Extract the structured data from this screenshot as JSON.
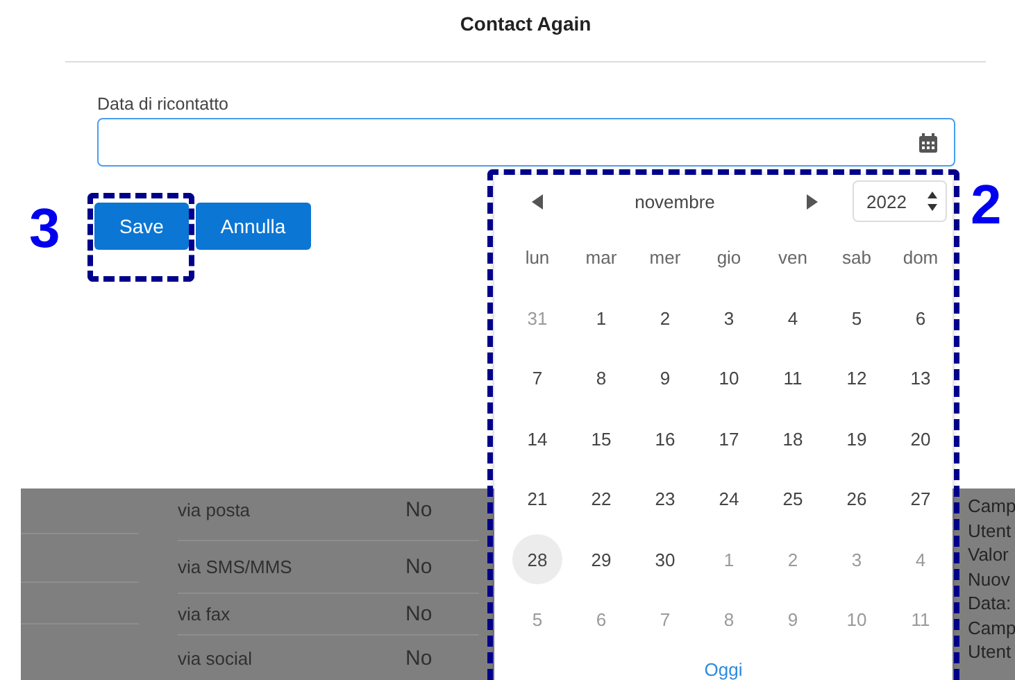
{
  "dialog": {
    "title": "Contact Again",
    "field": {
      "label": "Data di ricontatto"
    },
    "buttons": [
      {
        "label": "Save"
      },
      {
        "label": "Annulla"
      }
    ]
  },
  "background": {
    "rows": [
      {
        "channel": "via posta",
        "value": "No"
      },
      {
        "channel": "via SMS/MMS",
        "value": "No"
      },
      {
        "channel": "via fax",
        "value": "No"
      },
      {
        "channel": "via social",
        "value": "No"
      }
    ],
    "side_text": [
      "Camp",
      "Utent",
      "Valor",
      "Nuov",
      "Data:",
      "Camp",
      "Utent"
    ]
  },
  "datepicker": {
    "month": "novembre",
    "year": "2022",
    "weekdays": [
      "lun",
      "mar",
      "mer",
      "gio",
      "ven",
      "sab",
      "dom"
    ],
    "weeks": [
      [
        {
          "day": "31",
          "other_month": true,
          "today": false
        },
        {
          "day": "1",
          "other_month": false,
          "today": false
        },
        {
          "day": "2",
          "other_month": false,
          "today": false
        },
        {
          "day": "3",
          "other_month": false,
          "today": false
        },
        {
          "day": "4",
          "other_month": false,
          "today": false
        },
        {
          "day": "5",
          "other_month": false,
          "today": false
        },
        {
          "day": "6",
          "other_month": false,
          "today": false
        }
      ],
      [
        {
          "day": "7",
          "other_month": false,
          "today": false
        },
        {
          "day": "8",
          "other_month": false,
          "today": false
        },
        {
          "day": "9",
          "other_month": false,
          "today": false
        },
        {
          "day": "10",
          "other_month": false,
          "today": false
        },
        {
          "day": "11",
          "other_month": false,
          "today": false
        },
        {
          "day": "12",
          "other_month": false,
          "today": false
        },
        {
          "day": "13",
          "other_month": false,
          "today": false
        }
      ],
      [
        {
          "day": "14",
          "other_month": false,
          "today": false
        },
        {
          "day": "15",
          "other_month": false,
          "today": false
        },
        {
          "day": "16",
          "other_month": false,
          "today": false
        },
        {
          "day": "17",
          "other_month": false,
          "today": false
        },
        {
          "day": "18",
          "other_month": false,
          "today": false
        },
        {
          "day": "19",
          "other_month": false,
          "today": false
        },
        {
          "day": "20",
          "other_month": false,
          "today": false
        }
      ],
      [
        {
          "day": "21",
          "other_month": false,
          "today": false
        },
        {
          "day": "22",
          "other_month": false,
          "today": false
        },
        {
          "day": "23",
          "other_month": false,
          "today": false
        },
        {
          "day": "24",
          "other_month": false,
          "today": false
        },
        {
          "day": "25",
          "other_month": false,
          "today": false
        },
        {
          "day": "26",
          "other_month": false,
          "today": false
        },
        {
          "day": "27",
          "other_month": false,
          "today": false
        }
      ],
      [
        {
          "day": "28",
          "other_month": false,
          "today": true
        },
        {
          "day": "29",
          "other_month": false,
          "today": false
        },
        {
          "day": "30",
          "other_month": false,
          "today": false
        },
        {
          "day": "1",
          "other_month": true,
          "today": false
        },
        {
          "day": "2",
          "other_month": true,
          "today": false
        },
        {
          "day": "3",
          "other_month": true,
          "today": false
        },
        {
          "day": "4",
          "other_month": true,
          "today": false
        }
      ],
      [
        {
          "day": "5",
          "other_month": true,
          "today": false
        },
        {
          "day": "6",
          "other_month": true,
          "today": false
        },
        {
          "day": "7",
          "other_month": true,
          "today": false
        },
        {
          "day": "8",
          "other_month": true,
          "today": false
        },
        {
          "day": "9",
          "other_month": true,
          "today": false
        },
        {
          "day": "10",
          "other_month": true,
          "today": false
        },
        {
          "day": "11",
          "other_month": true,
          "today": false
        }
      ]
    ],
    "today_button": "Oggi"
  },
  "annotations": [
    {
      "label": "3"
    },
    {
      "label": "2"
    }
  ]
}
